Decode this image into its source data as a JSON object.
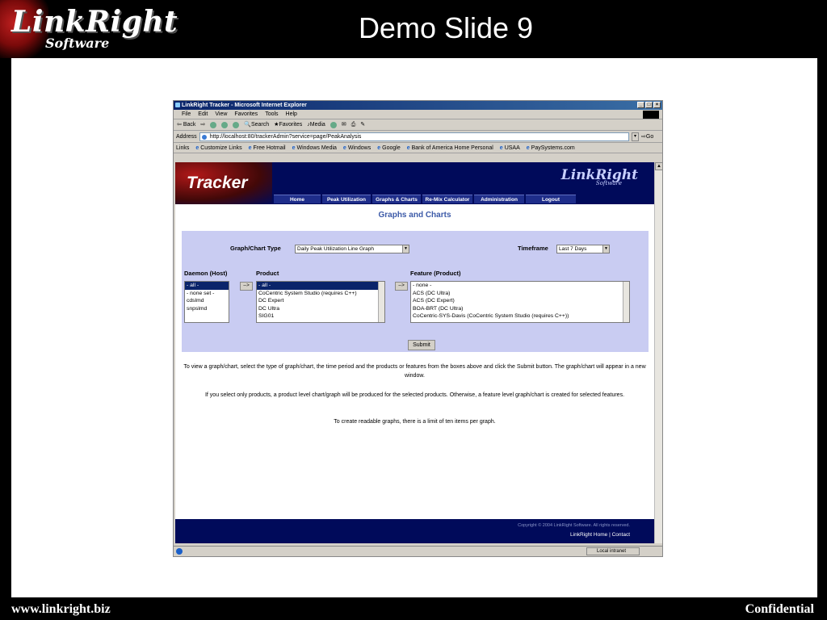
{
  "slide": {
    "title": "Demo Slide 9",
    "logo_brand": "LinkRight",
    "logo_sub": "Software",
    "footer_left": "www.linkright.biz",
    "footer_right": "Confidential"
  },
  "browser": {
    "window_title": "LinkRight Tracker - Microsoft Internet Explorer",
    "menu": [
      "File",
      "Edit",
      "View",
      "Favorites",
      "Tools",
      "Help"
    ],
    "toolbar": [
      "Back",
      "Search",
      "Favorites",
      "Media"
    ],
    "address_label": "Address",
    "address_value": "http://localhost:80/trackerAdmin?service=page/PeakAnalysis",
    "go_label": "Go",
    "links_label": "Links",
    "links": [
      "Customize Links",
      "Free Hotmail",
      "Windows Media",
      "Windows",
      "Google",
      "Bank of America Home Personal",
      "USAA",
      "PaySystems.com"
    ],
    "status_zone": "Local intranet"
  },
  "app": {
    "tracker_logo": "Tracker",
    "brand": "LinkRight",
    "brand_sub": "Software",
    "nav": [
      "Home",
      "Peak Utilization",
      "Graphs & Charts",
      "Re-Mix Calculator",
      "Administration",
      "Logout"
    ],
    "heading": "Graphs and Charts",
    "chart_type_label": "Graph/Chart Type",
    "chart_type_value": "Daily Peak Utilization Line Graph",
    "timeframe_label": "Timeframe",
    "timeframe_value": "Last 7 Days",
    "daemon_label": "Daemon (Host)",
    "daemon_options": [
      "- all -",
      "- none set -",
      "cdslmd",
      "snpslmd"
    ],
    "product_label": "Product",
    "product_options": [
      "- all -",
      "CoCentric System Studio (requires C++)",
      "DC Expert",
      "DC Ultra",
      "SIG01"
    ],
    "feature_label": "Feature (Product)",
    "feature_options": [
      "- none -",
      "ACS (DC Ultra)",
      "ACS (DC Expert)",
      "BOA-BRT (DC Ultra)",
      "CoCentric-SYS-Davis (CoCentric System Studio (requires C++))"
    ],
    "arrow_label": "-->",
    "submit_label": "Submit",
    "info1": "To view a graph/chart, select the type of graph/chart, the time period and the products or features from the boxes above and click the Submit button. The graph/chart will appear in a new window.",
    "info2": "If you select only products, a product level chart/graph will be produced for the selected products. Otherwise, a feature level graph/chart is created for selected features.",
    "info3": "To create readable graphs, there is a limit of ten items per graph.",
    "copyright": "Copyright © 2004 LinkRight Software. All rights reserved.",
    "footer_home": "LinkRight Home",
    "footer_sep": "|",
    "footer_contact": "Contact"
  }
}
